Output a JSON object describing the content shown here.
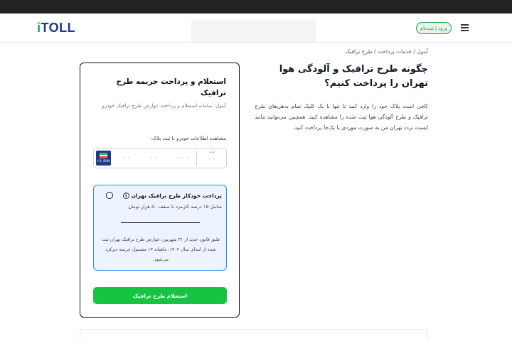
{
  "header": {
    "logo": {
      "mark": "i",
      "text": "TOLL"
    },
    "login_label": "ورود | ثبت‌نام",
    "menu_icon": "hamburger-menu-icon"
  },
  "breadcrumb": "آیتول / خدمات پرداخت / طرح ترافیک",
  "article": {
    "title": "چگونه طرح ترافیک و آلودگی هوا تهران را پرداخت کنیم؟",
    "body": "کافی است پلاک خود را وارد کنید تا تنها با یک کلیک تمام بدهی‌های طرح ترافیک و طرح آلودگی هوا ثبت شده را مشاهده کنید. همچنین می‌توانید مانند ایست تردد تهران من به صورت موردی یا یک‌جا پرداخت کنید."
  },
  "form": {
    "title": "استعلام و پرداخت جریمه طرح ترافیک",
    "subtitle": "آیتول؛ سامانه استعلام و پرداخت عوارض طرح ترافیک خودرو",
    "plate_label": "مشاهده اطلاعات خودرو با ثبت پلاک:",
    "plate": {
      "country_code": "I.R. IRAN",
      "seg1": "- -",
      "seg2": "- -",
      "seg3": "- - -",
      "seg4": "- -",
      "code_label": "ایران"
    },
    "option": {
      "title": "پرداخت خودکار طرح ترافیک تهران",
      "info_icon": "i",
      "fee": "شامل ۱۵ درصد کارمزد تا سقف ۵۰ هزار تومان",
      "note": "طبق قانون جدید از ۳۱ شهریور، عوارض طرح ترافیک تهران ثبت شده از ابتدای سال ۱۴۰۲، ماهیانه ۱۳ مشمول جریمه دیرکرد می‌شود."
    },
    "submit_label": "استعلام طرح ترافیک"
  },
  "colors": {
    "brand_green": "#16c442",
    "brand_blue": "#1e3a8a",
    "option_border": "#3b82f6",
    "option_bg": "#eef4ff"
  }
}
